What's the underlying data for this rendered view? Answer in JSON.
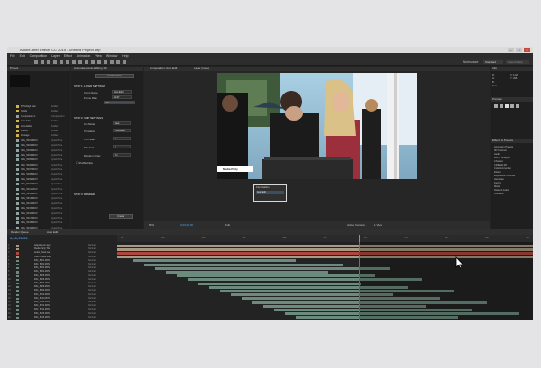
{
  "window": {
    "title": "Adobe After Effects CC 2015 - Untitled Project.aep",
    "controls": [
      "–",
      "□",
      "×"
    ]
  },
  "menu": [
    "File",
    "Edit",
    "Composition",
    "Layer",
    "Effect",
    "Animation",
    "View",
    "Window",
    "Help"
  ],
  "toolbar": {
    "workspace_label": "Workspace",
    "workspace_value": "Standard",
    "search_placeholder": "Search Help"
  },
  "project_panel": {
    "tab": "Project",
    "items": [
      {
        "name": "PiPLiDigit Stal",
        "type": "Folder"
      },
      {
        "name": "Solids",
        "type": "Folder"
      },
      {
        "name": "Composition 1",
        "type": "Composition"
      },
      {
        "name": "Auto Edit",
        "type": "Folder"
      },
      {
        "name": "Auto-Edits",
        "type": "Folder"
      },
      {
        "name": "Assets",
        "type": "Folder"
      },
      {
        "name": "Footage",
        "type": "Folder"
      },
      {
        "name": "IMG_5001.MOV",
        "type": "QuickTime"
      },
      {
        "name": "IMG_5002.MOV",
        "type": "QuickTime"
      },
      {
        "name": "IMG_5003.MOV",
        "type": "QuickTime"
      },
      {
        "name": "IMG_5004.MOV",
        "type": "QuickTime"
      },
      {
        "name": "IMG_5005.MOV",
        "type": "QuickTime"
      },
      {
        "name": "IMG_5006.MOV",
        "type": "QuickTime"
      },
      {
        "name": "IMG_5007.MOV",
        "type": "QuickTime"
      },
      {
        "name": "IMG_5008.MOV",
        "type": "QuickTime"
      },
      {
        "name": "IMG_5009.MOV",
        "type": "QuickTime"
      },
      {
        "name": "IMG_5010.MOV",
        "type": "QuickTime"
      },
      {
        "name": "IMG_5011.MOV",
        "type": "QuickTime"
      },
      {
        "name": "IMG_5012.MOV",
        "type": "QuickTime"
      },
      {
        "name": "IMG_5013.MOV",
        "type": "QuickTime"
      },
      {
        "name": "IMG_5014.MOV",
        "type": "QuickTime"
      },
      {
        "name": "IMG_5015.MOV",
        "type": "QuickTime"
      },
      {
        "name": "IMG_5016.MOV",
        "type": "QuickTime"
      },
      {
        "name": "IMG_5017.MOV",
        "type": "QuickTime"
      },
      {
        "name": "IMG_5018.MOV",
        "type": "QuickTime"
      },
      {
        "name": "IMG_5019.MOV",
        "type": "QuickTime"
      },
      {
        "name": "IMG_5020.MOV",
        "type": "QuickTime"
      },
      {
        "name": "IMG_5021.MOV",
        "type": "QuickTime"
      }
    ]
  },
  "effect_panel": {
    "tab": "Automated Auto-Editing 1.0",
    "edit_button": "AutoEdit Now",
    "sections": [
      "STEP 1: LAYER SETTINGS",
      "STEP 2: CLIP SETTINGS",
      "STEP 3: RENDER"
    ],
    "fields": [
      {
        "label": "Comp Name",
        "value": "Auto Edit"
      },
      {
        "label": "Frame Rate",
        "value": "29.97"
      },
      {
        "label": "Clip Duration",
        "value": "2.0"
      },
      {
        "label": "Cut Mode",
        "value": "Beat"
      },
      {
        "label": "Transition",
        "value": "Crossfade"
      },
      {
        "label": "Trim Start",
        "value": "0"
      },
      {
        "label": "Trim End",
        "value": "0"
      },
      {
        "label": "Random Order",
        "value": "On"
      }
    ],
    "checkbox": "Shuffle Clips",
    "render_button": "Create"
  },
  "composition_panel": {
    "tabs": [
      "Composition: Auto Edit",
      "Layer (none)"
    ],
    "footer_zoom": "50%",
    "footer_timecode": "0;00;00;00",
    "footer_resolution": "Full",
    "footer_view": "Active Camera",
    "footer_views": "1 View",
    "title_card": "Media Party"
  },
  "right_panels": {
    "info_tab": "Info",
    "info_rows": [
      "R:",
      "G:",
      "B:",
      "A: 0",
      "X: 1116",
      "Y: 396"
    ],
    "preview_tab": "Preview",
    "fx_tab": "Effects & Presets",
    "fx_items": [
      "Animation Presets",
      "3D Channel",
      "Audio",
      "Blur & Sharpen",
      "Channel",
      "CINEMA 4D",
      "Color Correction",
      "Distort",
      "Expression Controls",
      "Generate",
      "Keying",
      "Matte",
      "Noise & Grain",
      "Obsolete"
    ]
  },
  "timeline": {
    "tabs": [
      "Render Queue",
      "Auto Edit"
    ],
    "timecode": "0;00;00;00",
    "ruler_labels": [
      "0s",
      "02s",
      "04s",
      "06s",
      "08s",
      "10s",
      "12s",
      "14s",
      "16s",
      "18s",
      "20s"
    ],
    "layers": [
      {
        "num": "1",
        "name": "Adjustment Layer",
        "mode": "Normal"
      },
      {
        "num": "2",
        "name": "Media Party Title",
        "mode": "Normal"
      },
      {
        "num": "3",
        "name": "Audio_Track.wav",
        "mode": "Normal"
      },
      {
        "num": "4",
        "name": "Color Grade Solid",
        "mode": "Normal"
      },
      {
        "num": "5",
        "name": "IMG_5001.MOV",
        "mode": "Normal"
      },
      {
        "num": "6",
        "name": "IMG_5002.MOV",
        "mode": "Normal"
      },
      {
        "num": "7",
        "name": "IMG_5003.MOV",
        "mode": "Normal"
      },
      {
        "num": "8",
        "name": "IMG_5004.MOV",
        "mode": "Normal"
      },
      {
        "num": "9",
        "name": "IMG_5005.MOV",
        "mode": "Normal"
      },
      {
        "num": "10",
        "name": "IMG_5006.MOV",
        "mode": "Normal"
      },
      {
        "num": "11",
        "name": "IMG_5007.MOV",
        "mode": "Normal"
      },
      {
        "num": "12",
        "name": "IMG_5008.MOV",
        "mode": "Normal"
      },
      {
        "num": "13",
        "name": "IMG_5009.MOV",
        "mode": "Normal"
      },
      {
        "num": "14",
        "name": "IMG_5010.MOV",
        "mode": "Normal"
      },
      {
        "num": "15",
        "name": "IMG_5011.MOV",
        "mode": "Normal"
      },
      {
        "num": "16",
        "name": "IMG_5012.MOV",
        "mode": "Normal"
      },
      {
        "num": "17",
        "name": "IMG_5013.MOV",
        "mode": "Normal"
      },
      {
        "num": "18",
        "name": "IMG_5014.MOV",
        "mode": "Normal"
      },
      {
        "num": "19",
        "name": "IMG_5015.MOV",
        "mode": "Normal"
      },
      {
        "num": "20",
        "name": "IMG_5016.MOV",
        "mode": "Normal"
      }
    ],
    "tooltip_title": "Composition",
    "tooltip_item": "Auto Edit"
  },
  "colors": {
    "accent": "#4fa3e8",
    "red_bar": "#b0473f",
    "tan_bar": "#a89a86",
    "green_bar": "#6c8b7e",
    "panel_bg": "#1f1f1f"
  }
}
